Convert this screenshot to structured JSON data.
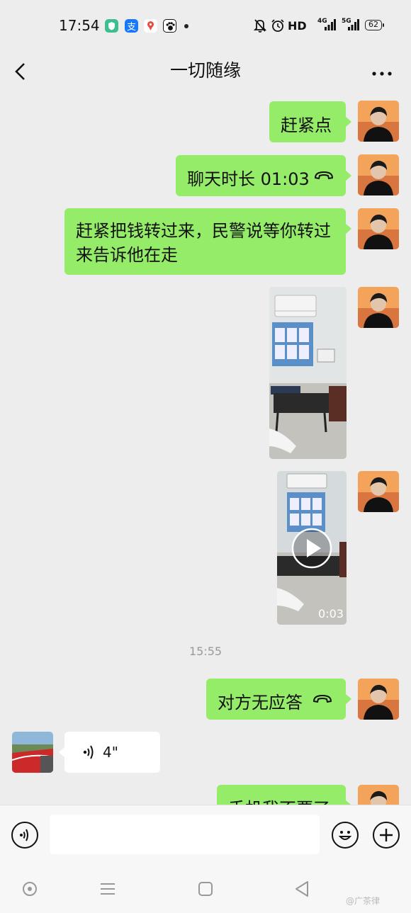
{
  "status_bar": {
    "time": "17:54",
    "hd": "HD",
    "net1": "4G",
    "net2": "5G",
    "battery": "62"
  },
  "header": {
    "title": "一切随缘"
  },
  "messages": [
    {
      "type": "text",
      "side": "right",
      "text": "赶紧点"
    },
    {
      "type": "call",
      "side": "right",
      "text": "聊天时长 01:03",
      "icon": "phone-hangup-icon"
    },
    {
      "type": "text",
      "side": "right",
      "text": "赶紧把钱转过来，民警说等你转过来告诉他在走"
    },
    {
      "type": "image",
      "side": "right"
    },
    {
      "type": "video",
      "side": "right",
      "duration": "0:03"
    },
    {
      "type": "time",
      "text": "15:55"
    },
    {
      "type": "call",
      "side": "right",
      "text": "对方无应答",
      "icon": "phone-hangup-icon"
    },
    {
      "type": "voice",
      "side": "left",
      "duration": "4\""
    },
    {
      "type": "text",
      "side": "right",
      "text": "手机我不要了"
    }
  ],
  "input_bar": {
    "placeholder": ""
  },
  "watermark": "@广茶律",
  "colors": {
    "bubble_self": "#95ec69",
    "background": "#ededed"
  }
}
